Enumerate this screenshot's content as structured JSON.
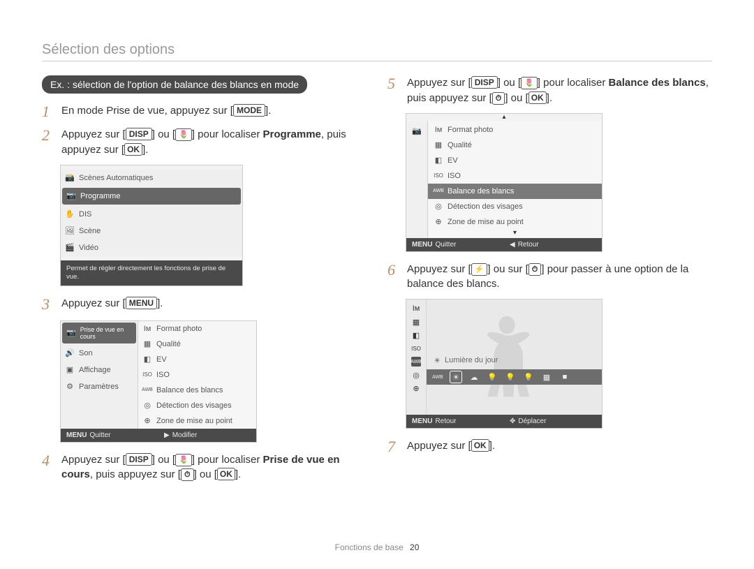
{
  "section_title": "Sélection des options",
  "callout": "Ex. : sélection de l'option de balance des blancs en mode",
  "keys": {
    "mode": "MODE",
    "disp": "DISP",
    "ok": "OK",
    "menu": "MENU",
    "macro": "🌷",
    "timer": "⏱",
    "flash": "⚡"
  },
  "steps": {
    "1": {
      "pre": "En mode Prise de vue, appuyez sur ["
    },
    "2": {
      "pre": "Appuyez sur [",
      "mid": "] ou [",
      "after_keys": "] pour localiser ",
      "bold": "Programme",
      "tail1": ", puis appuyez sur [",
      "tail2": "]."
    },
    "3": {
      "pre": "Appuyez sur ["
    },
    "4": {
      "pre": "Appuyez sur [",
      "mid": "] ou [",
      "after_keys": "] pour localiser ",
      "bold": "Prise de vue en cours",
      "tail1": ", puis appuyez sur [",
      "tail_mid": "] ou [",
      "tail2": "]."
    },
    "5": {
      "pre": "Appuyez sur [",
      "mid": "] ou [",
      "after_keys": "] pour localiser ",
      "bold": "Balance des blancs",
      "tail1": ", puis appuyez sur [",
      "tail_mid": "] ou [",
      "tail2": "]."
    },
    "6": {
      "pre": "Appuyez sur [",
      "mid": "] ou sur [",
      "after_keys": "] pour passer à une option de la balance des blancs."
    },
    "7": {
      "pre": "Appuyez sur ["
    }
  },
  "screen1": {
    "items": [
      "Scènes Automatiques",
      "Programme",
      "DIS",
      "Scène",
      "Vidéo"
    ],
    "desc": "Permet de régler directement les fonctions de prise de vue."
  },
  "screen2": {
    "left": [
      "Prise de vue en cours",
      "Son",
      "Affichage",
      "Paramètres"
    ],
    "right": [
      "Format photo",
      "Qualité",
      "EV",
      "ISO",
      "Balance des blancs",
      "Détection des visages",
      "Zone de mise au point"
    ],
    "footer_left_key": "MENU",
    "footer_left": "Quitter",
    "footer_right_icon": "▶",
    "footer_right": "Modifier"
  },
  "screen3": {
    "items": [
      "Format photo",
      "Qualité",
      "EV",
      "ISO",
      "Balance des blancs",
      "Détection des visages",
      "Zone de mise au point"
    ],
    "footer_left_key": "MENU",
    "footer_left": "Quitter",
    "footer_right_icon": "◀",
    "footer_right": "Retour"
  },
  "screen4": {
    "label": "Lumière du jour",
    "options": [
      "AWB",
      "☀",
      "☁",
      "💡",
      "💡",
      "💡",
      "▦",
      "■"
    ],
    "footer_left_key": "MENU",
    "footer_left": "Retour",
    "footer_right_icon": "✥",
    "footer_right": "Déplacer"
  },
  "icons": {
    "camera": "📷",
    "smart": "📸",
    "dis": "✋",
    "scene": "🖼",
    "video": "🎬",
    "sound": "🔊",
    "display": "▣",
    "settings": "⚙",
    "size": "Iм",
    "quality": "▦",
    "ev": "◧",
    "iso": "ISO",
    "awb": "AWB",
    "face": "◎",
    "focus": "⊹",
    "plus": "⊕",
    "menu": "MENU",
    "play": "▶",
    "back": "◀",
    "move": "✥"
  },
  "footer": {
    "label": "Fonctions de base",
    "page": "20"
  }
}
